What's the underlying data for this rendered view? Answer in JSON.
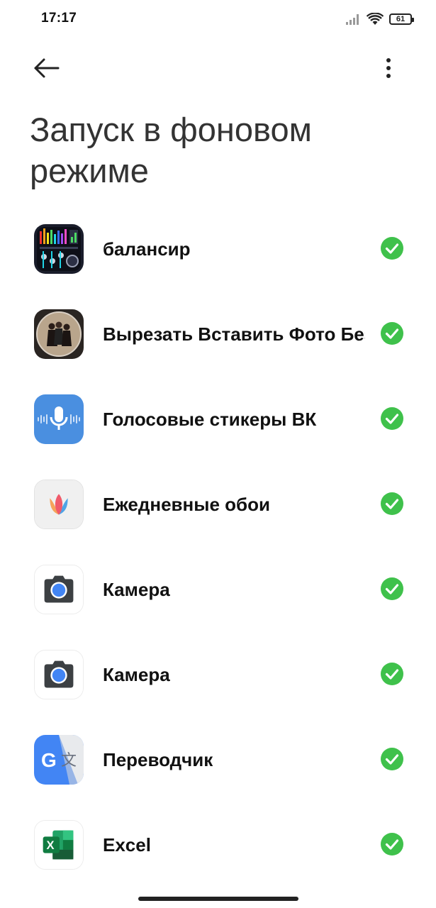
{
  "status_bar": {
    "time": "17:17",
    "battery": "61"
  },
  "header": {
    "title": "Запуск в фоновом режиме"
  },
  "apps": [
    {
      "label": "балансир",
      "icon": "equalizer-app-icon",
      "checked": true
    },
    {
      "label": "Вырезать Вставить Фото Без Фона",
      "icon": "cut-paste-photo-app-icon",
      "checked": true
    },
    {
      "label": "Голосовые стикеры ВК",
      "icon": "voice-stickers-app-icon",
      "checked": true
    },
    {
      "label": "Ежедневные обои",
      "icon": "daily-wallpapers-app-icon",
      "checked": true
    },
    {
      "label": "Камера",
      "icon": "camera-app-icon",
      "checked": true
    },
    {
      "label": "Камера",
      "icon": "camera-app-icon",
      "checked": true
    },
    {
      "label": "Переводчик",
      "icon": "translate-app-icon",
      "checked": true
    },
    {
      "label": "Excel",
      "icon": "excel-app-icon",
      "checked": true
    }
  ],
  "colors": {
    "check_green": "#3fc14b",
    "title_gray": "#333333"
  }
}
